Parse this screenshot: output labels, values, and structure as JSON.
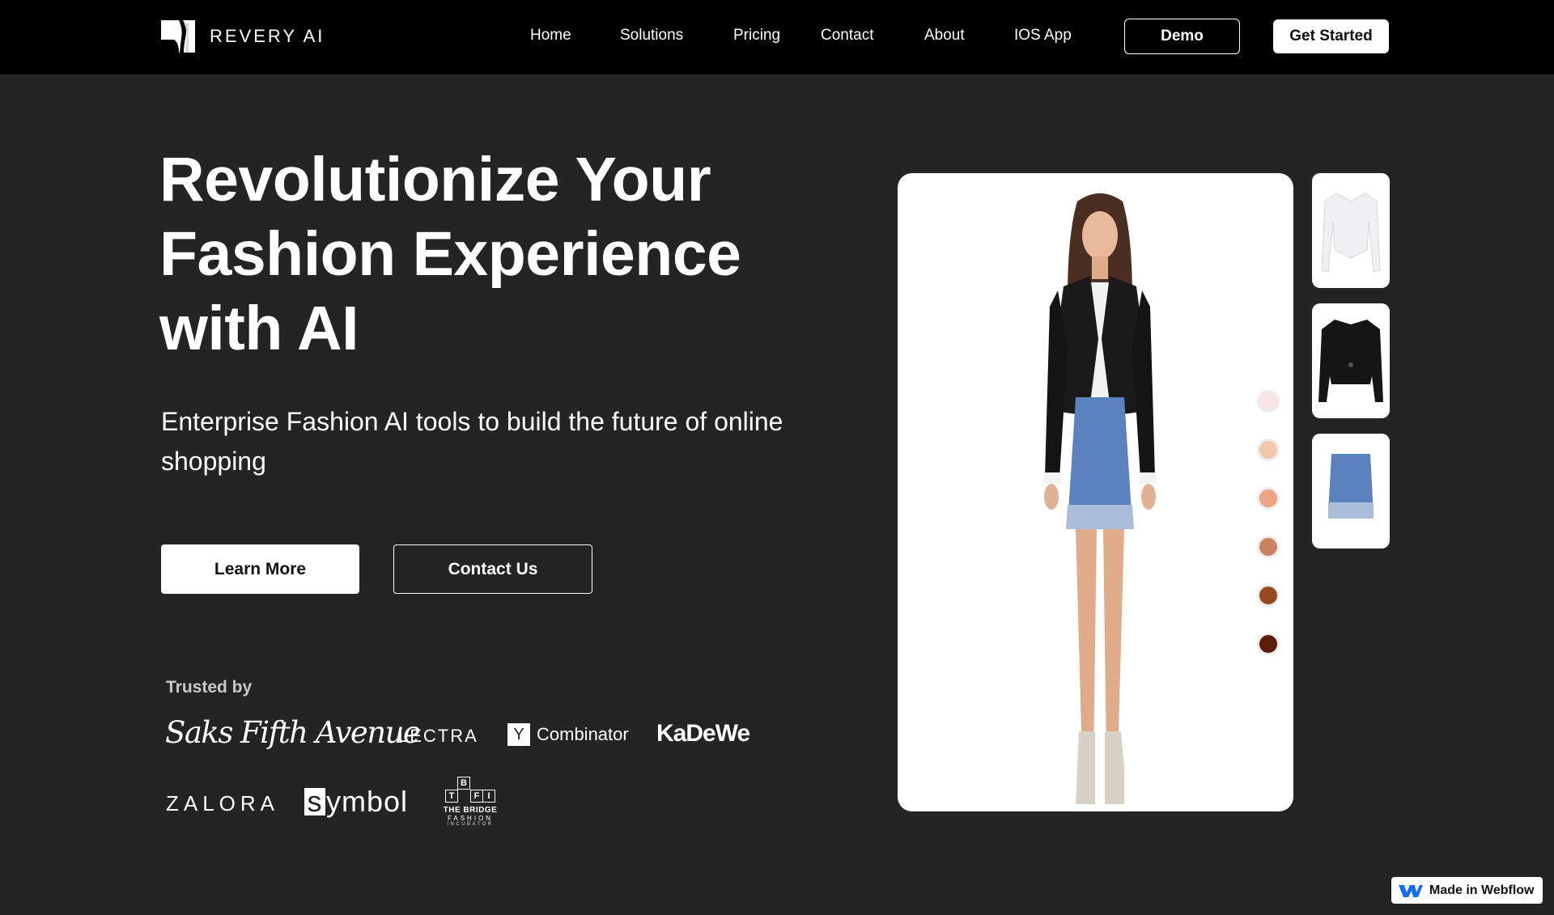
{
  "nav": {
    "logo_text": "REVERY AI",
    "links": [
      "Home",
      "Solutions",
      "Pricing",
      "Contact",
      "About",
      "IOS App"
    ],
    "demo_label": "Demo",
    "get_started_label": "Get Started"
  },
  "hero": {
    "title_lines": [
      "Revolutionize Your",
      "Fashion Experience",
      "with AI"
    ],
    "subtitle": "Enterprise Fashion AI tools to build the future of online shopping",
    "learn_more_label": "Learn More",
    "contact_us_label": "Contact Us"
  },
  "trusted": {
    "heading": "Trusted by",
    "brands": {
      "saks": "Saks Fifth Avenue",
      "lectra": "LECTRA",
      "yc_mark": "Y",
      "yc_text": "Combinator",
      "kadewe": "KaDeWe",
      "zalora": "ZALORA",
      "symbol_s": "s",
      "symbol_rest": "ymbol",
      "tbfi_cells": [
        "B",
        "T",
        "F",
        "I"
      ],
      "tbfi_line1": "THE BRIDGE",
      "tbfi_line2": "FASHION",
      "tbfi_line3": "INCUBATOR"
    }
  },
  "viewer": {
    "skin_tones": [
      "#fde4e4",
      "#f1c8ae",
      "#eda482",
      "#c98260",
      "#974820",
      "#5a1f08"
    ],
    "thumbnails": [
      "white-corset-top",
      "black-leather-jacket",
      "blue-tweed-skirt"
    ]
  },
  "badge": {
    "label": "Made in Webflow"
  }
}
